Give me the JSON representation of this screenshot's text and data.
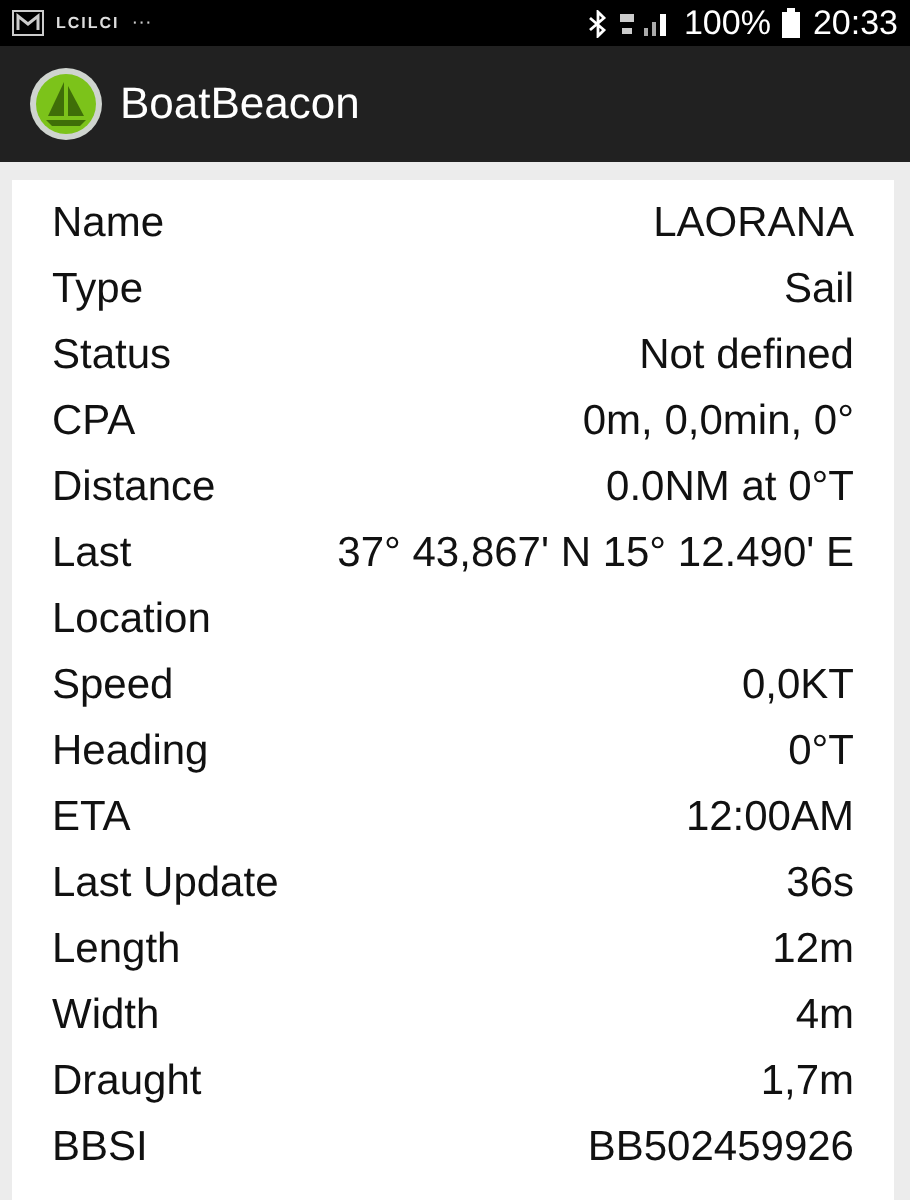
{
  "status_bar": {
    "notifications": "LCILCI",
    "more": "···",
    "battery_text": "100%",
    "time": "20:33"
  },
  "app_bar": {
    "title": "BoatBeacon"
  },
  "details": [
    {
      "label": "Name",
      "value": "LAORANA"
    },
    {
      "label": "Type",
      "value": "Sail"
    },
    {
      "label": "Status",
      "value": "Not defined"
    },
    {
      "label": "CPA",
      "value": "0m, 0,0min, 0°"
    },
    {
      "label": "Distance",
      "value": "0.0NM at 0°T"
    },
    {
      "label": "Last Location",
      "value": "37° 43,867' N 15° 12.490' E"
    },
    {
      "label": "Speed",
      "value": "0,0KT"
    },
    {
      "label": "Heading",
      "value": "0°T"
    },
    {
      "label": "ETA",
      "value": "12:00AM"
    },
    {
      "label": "Last Update",
      "value": "36s"
    },
    {
      "label": "Length",
      "value": "12m"
    },
    {
      "label": "Width",
      "value": "4m"
    },
    {
      "label": "Draught",
      "value": "1,7m"
    },
    {
      "label": "BBSI",
      "value": "BB502459926"
    }
  ]
}
